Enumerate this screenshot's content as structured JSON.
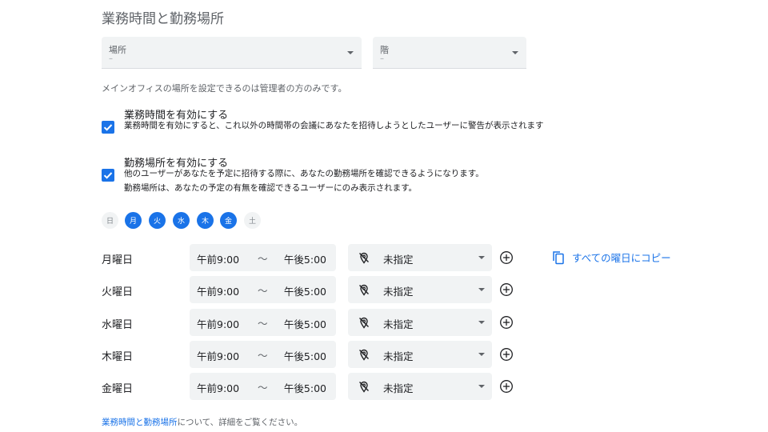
{
  "section_title": "業務時間と勤務場所",
  "place_select": {
    "label": "場所",
    "value": "–"
  },
  "floor_select": {
    "label": "階",
    "value": "–"
  },
  "admin_note": "メインオフィスの場所を設定できるのは管理者の方のみです。",
  "working_hours": {
    "checked": true,
    "title": "業務時間を有効にする",
    "description": "業務時間を有効にすると、これ以外の時間帯の会議にあなたを招待しようとしたユーザーに警告が表示されます"
  },
  "working_location": {
    "checked": true,
    "title": "勤務場所を有効にする",
    "description_1": "他のユーザーがあなたを予定に招待する際に、あなたの勤務場所を確認できるようになります。",
    "description_2": "勤務場所は、あなたの予定の有無を確認できるユーザーにのみ表示されます。"
  },
  "weekdays": [
    {
      "label": "日",
      "selected": false
    },
    {
      "label": "月",
      "selected": true
    },
    {
      "label": "火",
      "selected": true
    },
    {
      "label": "水",
      "selected": true
    },
    {
      "label": "木",
      "selected": true
    },
    {
      "label": "金",
      "selected": true
    },
    {
      "label": "土",
      "selected": false
    }
  ],
  "schedule": [
    {
      "day": "月曜日",
      "start": "午前9:00",
      "end": "午後5:00",
      "location": "未指定"
    },
    {
      "day": "火曜日",
      "start": "午前9:00",
      "end": "午後5:00",
      "location": "未指定"
    },
    {
      "day": "水曜日",
      "start": "午前9:00",
      "end": "午後5:00",
      "location": "未指定"
    },
    {
      "day": "木曜日",
      "start": "午前9:00",
      "end": "午後5:00",
      "location": "未指定"
    },
    {
      "day": "金曜日",
      "start": "午前9:00",
      "end": "午後5:00",
      "location": "未指定"
    }
  ],
  "range_separator": "〜",
  "copy_all_label": "すべての曜日にコピー",
  "footer": {
    "link": "業務時間と勤務場所",
    "suffix": "について、詳細をご覧ください。"
  },
  "colors": {
    "accent": "#1a73e8",
    "field_bg": "#f1f3f4",
    "muted_text": "#5f6368"
  },
  "icons": {
    "location_off": "location-off-icon",
    "add": "add-circle-icon",
    "copy": "copy-icon"
  }
}
